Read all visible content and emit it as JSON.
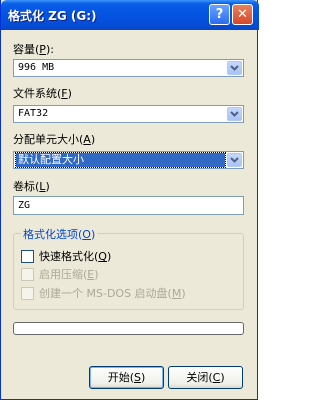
{
  "window": {
    "title": "格式化 ZG (G:)",
    "help_label": "?",
    "close_label": "✕"
  },
  "capacity": {
    "label": "容量",
    "hotkey": "P",
    "value": "996 MB"
  },
  "filesystem": {
    "label": "文件系统",
    "hotkey": "F",
    "value": "FAT32"
  },
  "allocation": {
    "label": "分配单元大小",
    "hotkey": "A",
    "value": "默认配置大小"
  },
  "volume_label": {
    "label": "卷标",
    "hotkey": "L",
    "value": "ZG"
  },
  "format_options": {
    "title": "格式化选项",
    "hotkey": "O",
    "quick_format": {
      "label": "快速格式化",
      "hotkey": "Q",
      "checked": false,
      "enabled": true
    },
    "compression": {
      "label": "启用压缩",
      "hotkey": "E",
      "checked": false,
      "enabled": false
    },
    "boot_disk": {
      "label": "创建一个 MS-DOS 启动盘",
      "hotkey": "M",
      "checked": false,
      "enabled": false
    }
  },
  "progress": {
    "value": 0
  },
  "buttons": {
    "start": {
      "label": "开始",
      "hotkey": "S"
    },
    "close": {
      "label": "关闭",
      "hotkey": "C"
    }
  },
  "colors": {
    "titlebar": "#0554e3",
    "dialog_bg": "#ece9d8",
    "selection": "#316ac5",
    "group_title": "#0046d5"
  }
}
